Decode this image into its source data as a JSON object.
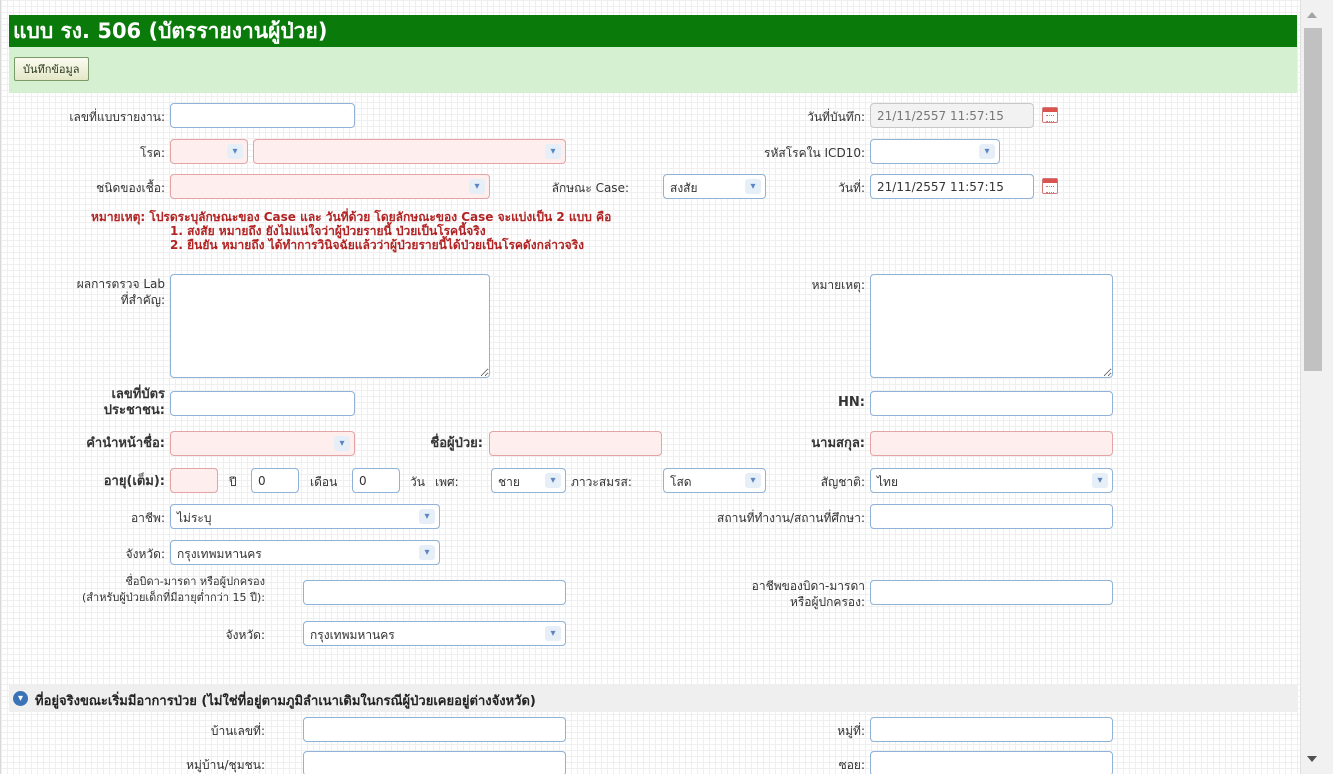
{
  "header": {
    "title": "แบบ รง. 506 (บัตรรายงานผู้ป่วย)"
  },
  "toolbar": {
    "save_label": "บันทึกข้อมูล"
  },
  "labels": {
    "report_no": "เลขที่แบบรายงาน:",
    "record_date": "วันที่บันทึก:",
    "disease": "โรค:",
    "icd10": "รหัสโรคใน ICD10:",
    "pathogen": "ชนิดของเชื้อ:",
    "case_type": "ลักษณะ Case:",
    "date": "วันที่:",
    "lab_1": "ผลการตรวจ Lab",
    "lab_2": "ที่สำคัญ:",
    "remark": "หมายเหตุ:",
    "id_1": "เลขที่บัตร",
    "id_2": "ประชาชน:",
    "hn": "HN:",
    "prefix": "คำนำหน้าชื่อ:",
    "patient_name": "ชื่อผู้ป่วย:",
    "surname": "นามสกุล:",
    "age": "อายุ(เต็ม):",
    "year": "ปี",
    "month": "เดือน",
    "day": "วัน",
    "sex": "เพศ:",
    "marital": "ภาวะสมรส:",
    "nationality": "สัญชาติ:",
    "occupation": "อาชีพ:",
    "workplace": "สถานที่ทำงาน/สถานที่ศึกษา:",
    "province": "จังหวัด:",
    "parent_1": "ชื่อบิดา-มารดา หรือผู้ปกครอง",
    "parent_2": "(สำหรับผู้ป่วยเด็กที่มีอายุต่ำกว่า 15 ปี):",
    "parent_occ_1": "อาชีพของบิดา-มารดา",
    "parent_occ_2": "หรือผู้ปกครอง:",
    "parent_province": "จังหวัด:",
    "house_no": "บ้านเลขที่:",
    "moo": "หมู่ที่:",
    "village": "หมู่บ้าน/ชุมชน:",
    "soi": "ซอย:"
  },
  "values": {
    "record_date": "21/11/2557 11:57:15",
    "date": "21/11/2557 11:57:15",
    "case_type": "สงสัย",
    "age_month": "0",
    "age_day": "0",
    "sex": "ชาย",
    "marital": "โสด",
    "nationality": "ไทย",
    "occupation": "ไม่ระบุ",
    "province": "กรุงเทพมหานคร",
    "parent_province": "กรุงเทพมหานคร"
  },
  "note": {
    "line1": "หมายเหตุ: โปรดระบุลักษณะของ Case และ วันที่ด้วย โดยลักษณะของ Case จะแบ่งเป็น 2 แบบ คือ",
    "line2": "1. สงสัย หมายถึง ยังไม่แน่ใจว่าผู้ป่วยรายนี้ ป่วยเป็นโรคนี้จริง",
    "line3": "2. ยืนยัน หมายถึง ได้ทำการวินิจฉัยแล้วว่าผู้ป่วยรายนี้ได้ป่วยเป็นโรคดังกล่าวจริง"
  },
  "section": {
    "title": "ที่อยู่จริงขณะเริ่มมีอาการป่วย (ไม่ใช่ที่อยู่ตามภูมิลำเนาเดิมในกรณีผู้ป่วยเคยอยู่ต่างจังหวัด)"
  },
  "icons": {
    "calendar": "calendar-icon",
    "chevron": "chevron-down-icon",
    "section": "chevron-circle-icon"
  },
  "colors": {
    "title_bg": "#0a7a0a",
    "toolbar_bg": "#d4f0d0",
    "note_text": "#b22222",
    "required_bg": "#ffeeee",
    "field_border": "#8fb2d6"
  }
}
